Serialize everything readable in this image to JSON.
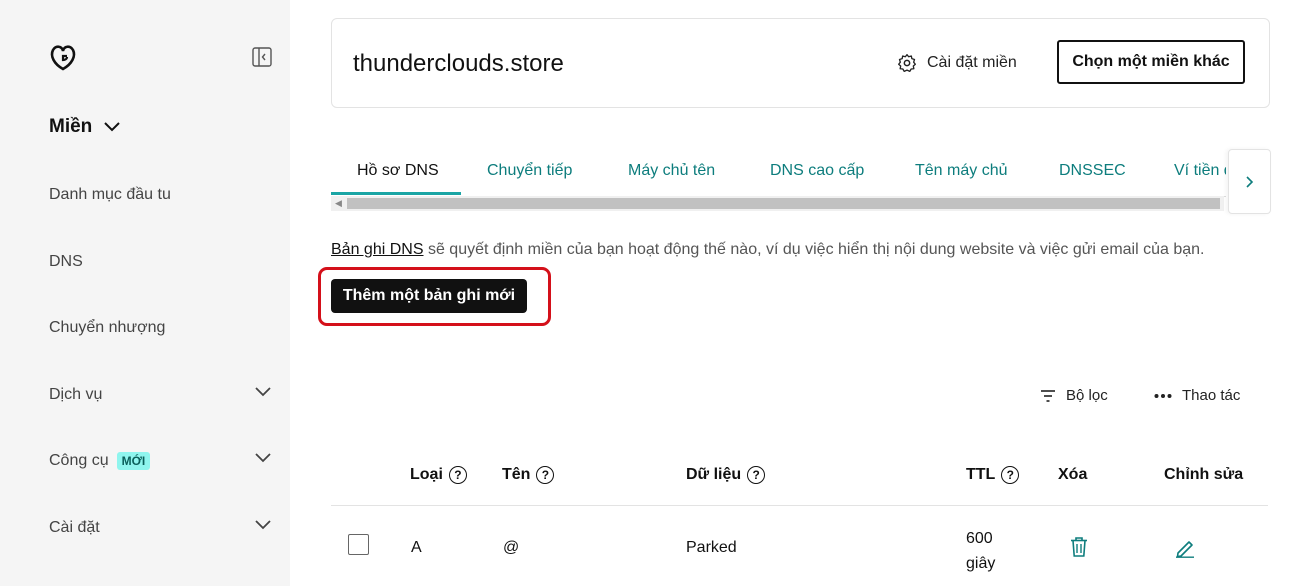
{
  "sidebar": {
    "section_title": "Miền",
    "items": [
      {
        "label": "Danh mục đầu tu"
      },
      {
        "label": "DNS"
      },
      {
        "label": "Chuyển nhượng"
      },
      {
        "label": "Dịch vụ"
      },
      {
        "label": "Công cụ",
        "badge": "MỚI"
      },
      {
        "label": "Cài đặt"
      }
    ]
  },
  "header": {
    "domain": "thunderclouds.store",
    "settings_label": "Cài đặt miền",
    "choose_domain_label": "Chọn một miền khác"
  },
  "tabs": [
    {
      "label": "Hồ sơ DNS"
    },
    {
      "label": "Chuyển tiếp"
    },
    {
      "label": "Máy chủ tên"
    },
    {
      "label": "DNS cao cấp"
    },
    {
      "label": "Tên máy chủ"
    },
    {
      "label": "DNSSEC"
    },
    {
      "label": "Ví tiền điện tử"
    }
  ],
  "description": {
    "link": "Bản ghi DNS",
    "text": " sẽ quyết định miền của bạn hoạt động thế nào, ví dụ việc hiển thị nội dung website và việc gửi email của bạn."
  },
  "add_record_label": "Thêm một bản ghi mới",
  "toolbar": {
    "filter_label": "Bộ lọc",
    "actions_label": "Thao tác"
  },
  "table": {
    "columns": {
      "type": "Loại",
      "name": "Tên",
      "data": "Dữ liệu",
      "ttl": "TTL",
      "delete": "Xóa",
      "edit": "Chỉnh sửa"
    },
    "rows": [
      {
        "type": "A",
        "name": "@",
        "data": "Parked",
        "ttl_value": "600",
        "ttl_unit": "giây"
      }
    ]
  },
  "colors": {
    "accent": "#1aa5a5",
    "link": "#0d7d7d",
    "highlight": "#d4101a",
    "badge": "#8ff5ee"
  }
}
